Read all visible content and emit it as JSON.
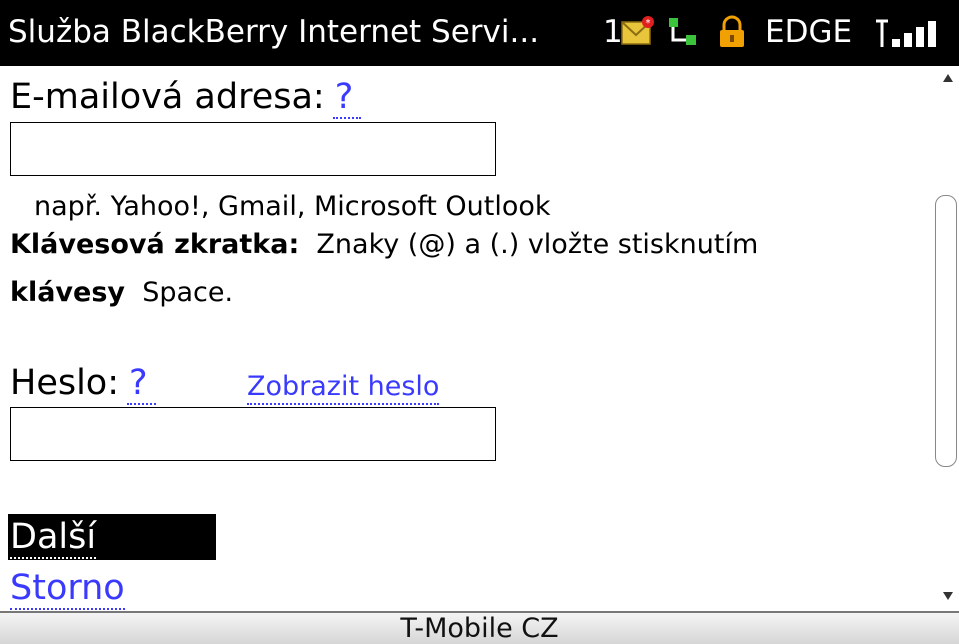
{
  "titlebar": {
    "title": "Služba BlackBerry Internet Servi...",
    "notification_count": "1",
    "network": "EDGE",
    "icons": [
      "mail-icon",
      "connection-icon",
      "lock-icon",
      "signal-icon"
    ]
  },
  "form": {
    "email_label": "E-mailová adresa:",
    "email_help": "?",
    "email_value": "",
    "email_hint": "např. Yahoo!, Gmail, Microsoft Outlook",
    "shortcut_bold": "Klávesová zkratka:",
    "shortcut_text": "Znaky (@) a (.) vložte stisknutím",
    "shortcut_bold2": "klávesy",
    "shortcut_text2": "Space.",
    "password_label": "Heslo:",
    "password_help": "?",
    "show_password": "Zobrazit heslo",
    "password_value": "",
    "next_label": "Další",
    "cancel_label": "Storno"
  },
  "footer": {
    "carrier": "T-Mobile CZ"
  },
  "colors": {
    "link": "#3a3aff",
    "titlebar_bg": "#000000"
  }
}
